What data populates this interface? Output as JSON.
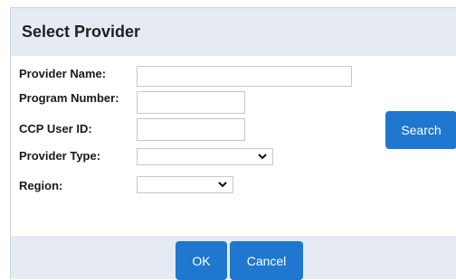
{
  "dialog": {
    "title": "Select Provider"
  },
  "form": {
    "provider_name_label": "Provider Name:",
    "provider_name_value": "",
    "program_number_label": "Program Number:",
    "program_number_value": "",
    "ccp_user_id_label": "CCP User ID:",
    "ccp_user_id_value": "",
    "provider_type_label": "Provider Type:",
    "provider_type_selected": "",
    "region_label": "Region:",
    "region_selected": ""
  },
  "buttons": {
    "search": "Search",
    "ok": "OK",
    "cancel": "Cancel"
  },
  "icons": {
    "dropdown": "chevron-down-icon"
  },
  "colors": {
    "primary_button": "#1f77d0",
    "panel_background": "#e6ebf3"
  }
}
